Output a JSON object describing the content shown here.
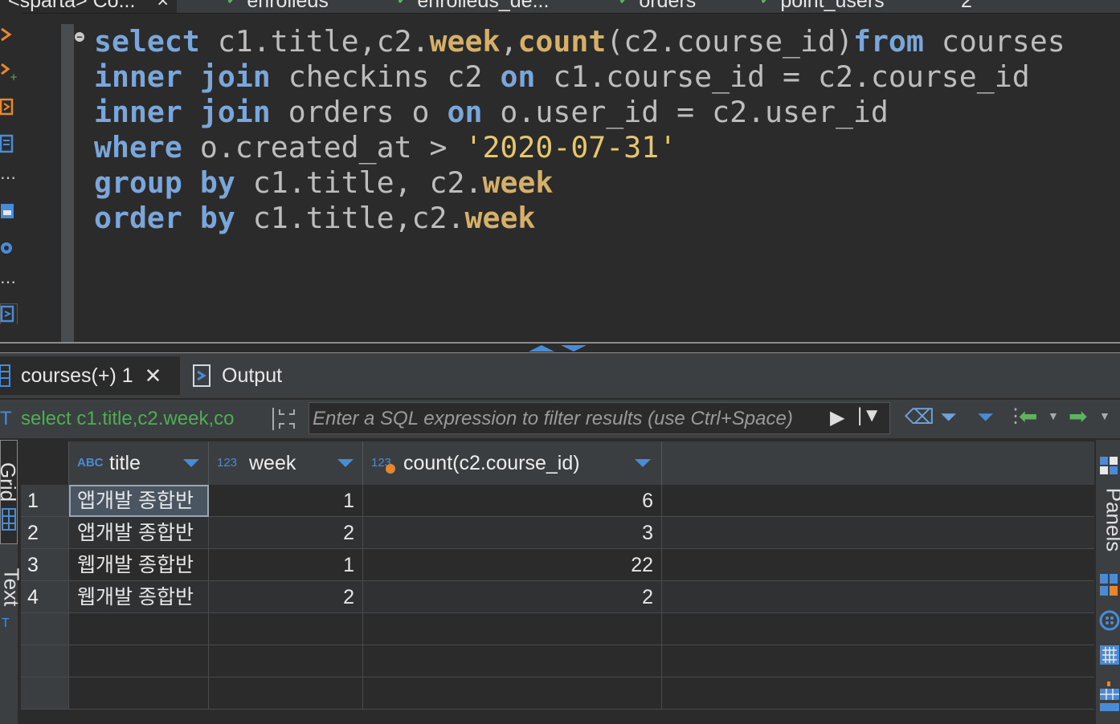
{
  "editor_tabs": [
    {
      "label": "<sparta> Co...",
      "active": true
    },
    {
      "label": "enrolleds"
    },
    {
      "label": "enrolleds_de..."
    },
    {
      "label": "orders"
    },
    {
      "label": "point_users"
    },
    {
      "label": "2"
    }
  ],
  "editor": {
    "lines": [
      [
        [
          "kw",
          "select"
        ],
        [
          "p",
          " c1.title,c2."
        ],
        [
          "fn",
          "week"
        ],
        [
          "p",
          ","
        ],
        [
          "fn",
          "count"
        ],
        [
          "p",
          "(c2.course_id)"
        ],
        [
          "kw",
          "from"
        ],
        [
          "p",
          " courses"
        ]
      ],
      [
        [
          "kw",
          "inner join"
        ],
        [
          "p",
          " checkins c2 "
        ],
        [
          "kw",
          "on"
        ],
        [
          "p",
          " c1.course_id = c2.course_id"
        ]
      ],
      [
        [
          "kw",
          "inner join"
        ],
        [
          "p",
          " orders o "
        ],
        [
          "kw",
          "on"
        ],
        [
          "p",
          " o.user_id = c2.user_id"
        ]
      ],
      [
        [
          "kw",
          "where"
        ],
        [
          "p",
          " o.created_at > "
        ],
        [
          "str",
          "'2020-07-31'"
        ]
      ],
      [
        [
          "kw",
          "group by"
        ],
        [
          "p",
          " c1.title, c2."
        ],
        [
          "fn",
          "week"
        ]
      ],
      [
        [
          "kw",
          "order by"
        ],
        [
          "p",
          " c1.title,c2."
        ],
        [
          "fn",
          "week"
        ]
      ]
    ]
  },
  "result_tabs": {
    "results_label": "courses(+) 1",
    "output_label": "Output"
  },
  "filter": {
    "query_preview": "select c1.title,c2.week,co",
    "placeholder": "Enter a SQL expression to filter results (use Ctrl+Space)"
  },
  "side_tabs": {
    "grid": "Grid",
    "text": "Text"
  },
  "right_panel": {
    "panels": "Panels"
  },
  "grid": {
    "columns": [
      {
        "type": "ABC",
        "name": "title"
      },
      {
        "type": "123",
        "name": "week"
      },
      {
        "type": "123",
        "name": "count(c2.course_id)"
      }
    ],
    "rows": [
      {
        "n": "1",
        "title": "앱개발 종합반",
        "week": "1",
        "count": "6"
      },
      {
        "n": "2",
        "title": "앱개발 종합반",
        "week": "2",
        "count": "3"
      },
      {
        "n": "3",
        "title": "웹개발 종합반",
        "week": "1",
        "count": "22"
      },
      {
        "n": "4",
        "title": "웹개발 종합반",
        "week": "2",
        "count": "2"
      }
    ]
  },
  "colors": {
    "keyword": "#7aa6da",
    "function": "#d4b06a",
    "string": "#e6c76b",
    "accent": "#4a8bd6",
    "query_green": "#4caf50"
  }
}
